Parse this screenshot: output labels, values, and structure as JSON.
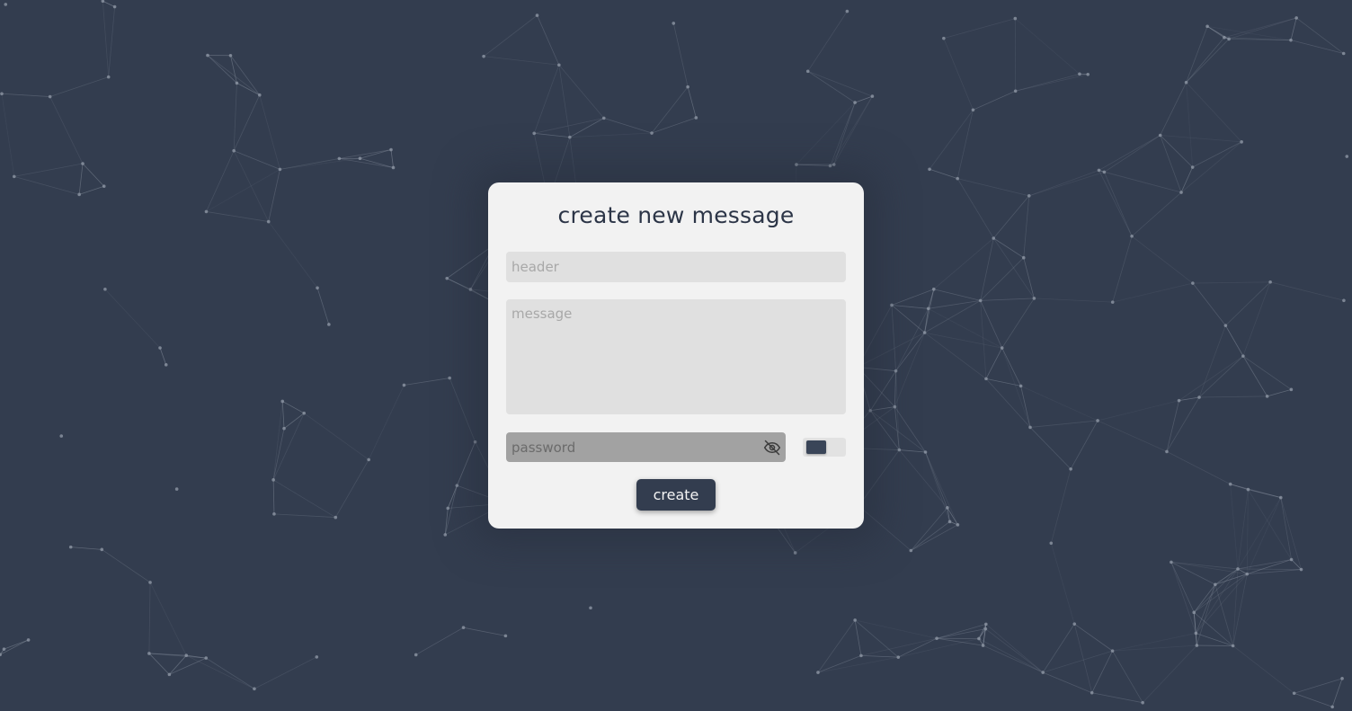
{
  "page": {
    "background_color": "#333d4f",
    "network_color": "#8d96a4"
  },
  "form": {
    "title": "create new message",
    "header_placeholder": "header",
    "message_placeholder": "message",
    "password_placeholder": "password",
    "password_visibility_icon": "eye-slash-icon",
    "encrypt_toggle_on": false,
    "create_label": "create"
  }
}
